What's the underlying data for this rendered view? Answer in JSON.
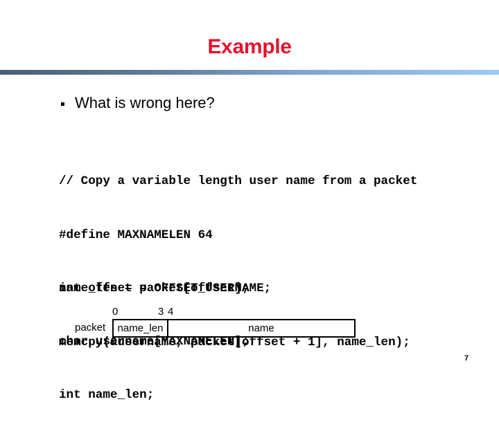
{
  "slide": {
    "title": "Example",
    "title_color": "#e3122f",
    "rule_gradient": [
      "#4a5f75",
      "#9ccaf6"
    ],
    "bullets": [
      {
        "icon": "square-bullet-icon",
        "text": "What is wrong here?"
      }
    ],
    "code_block_1": [
      "// Copy a variable length user name from a packet",
      "#define MAXNAMELEN 64",
      "int offset = OFFSET_USERNAME;",
      "char username[MAXNAMELEN];",
      "int name_len;"
    ],
    "code_block_2": [
      "name_len = packet[offset];",
      "memcpy(&username, packet[offset + 1], name_len);"
    ],
    "diagram": {
      "row_label": "packet",
      "indices": [
        "0",
        "3",
        "4"
      ],
      "fields": [
        {
          "label": "name_len"
        },
        {
          "label": "name"
        }
      ]
    },
    "page_number": "7"
  }
}
